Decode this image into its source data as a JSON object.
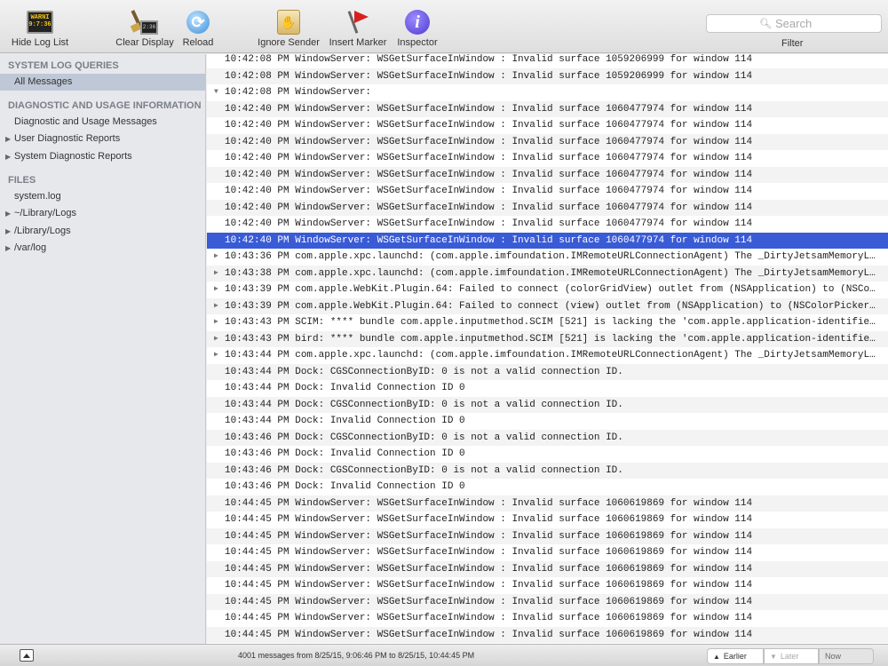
{
  "toolbar": {
    "hide_log_list": "Hide Log List",
    "clear_display": "Clear Display",
    "reload": "Reload",
    "ignore_sender": "Ignore Sender",
    "insert_marker": "Insert Marker",
    "inspector": "Inspector",
    "console_icon_text": "WARNI\n9:7:36",
    "clear_icon_text": "2:36",
    "search_placeholder": "Search",
    "filter": "Filter"
  },
  "sidebar": {
    "system_log_queries": "SYSTEM LOG QUERIES",
    "all_messages": "All Messages",
    "diagnostic_header": "DIAGNOSTIC AND USAGE INFORMATION",
    "diagnostic_messages": "Diagnostic and Usage Messages",
    "user_reports": "User Diagnostic Reports",
    "system_reports": "System Diagnostic Reports",
    "files_header": "FILES",
    "system_log": "system.log",
    "user_library_logs": "~/Library/Logs",
    "library_logs": "/Library/Logs",
    "var_log": "/var/log"
  },
  "log": {
    "rows": [
      {
        "text": "10:42:08 PM WindowServer: WSGetSurfaceInWindow : Invalid surface 1059206999 for window 114",
        "disc": ""
      },
      {
        "text": "10:42:08 PM WindowServer: WSGetSurfaceInWindow : Invalid surface 1059206999 for window 114",
        "disc": ""
      },
      {
        "text": "10:42:08 PM WindowServer:",
        "disc": "▼"
      },
      {
        "text": "10:42:40 PM WindowServer: WSGetSurfaceInWindow : Invalid surface 1060477974 for window 114",
        "disc": ""
      },
      {
        "text": "10:42:40 PM WindowServer: WSGetSurfaceInWindow : Invalid surface 1060477974 for window 114",
        "disc": ""
      },
      {
        "text": "10:42:40 PM WindowServer: WSGetSurfaceInWindow : Invalid surface 1060477974 for window 114",
        "disc": ""
      },
      {
        "text": "10:42:40 PM WindowServer: WSGetSurfaceInWindow : Invalid surface 1060477974 for window 114",
        "disc": ""
      },
      {
        "text": "10:42:40 PM WindowServer: WSGetSurfaceInWindow : Invalid surface 1060477974 for window 114",
        "disc": ""
      },
      {
        "text": "10:42:40 PM WindowServer: WSGetSurfaceInWindow : Invalid surface 1060477974 for window 114",
        "disc": ""
      },
      {
        "text": "10:42:40 PM WindowServer: WSGetSurfaceInWindow : Invalid surface 1060477974 for window 114",
        "disc": ""
      },
      {
        "text": "10:42:40 PM WindowServer: WSGetSurfaceInWindow : Invalid surface 1060477974 for window 114",
        "disc": ""
      },
      {
        "text": "10:42:40 PM WindowServer: WSGetSurfaceInWindow : Invalid surface 1060477974 for window 114",
        "disc": "",
        "selected": true
      },
      {
        "text": "10:43:36 PM com.apple.xpc.launchd: (com.apple.imfoundation.IMRemoteURLConnectionAgent) The _DirtyJetsamMemoryL…",
        "disc": "▶"
      },
      {
        "text": "10:43:38 PM com.apple.xpc.launchd: (com.apple.imfoundation.IMRemoteURLConnectionAgent) The _DirtyJetsamMemoryL…",
        "disc": "▶"
      },
      {
        "text": "10:43:39 PM com.apple.WebKit.Plugin.64: Failed to connect (colorGridView) outlet from (NSApplication) to (NSCo…",
        "disc": "▶"
      },
      {
        "text": "10:43:39 PM com.apple.WebKit.Plugin.64: Failed to connect (view) outlet from (NSApplication) to (NSColorPicker…",
        "disc": "▶"
      },
      {
        "text": "10:43:43 PM SCIM: **** bundle com.apple.inputmethod.SCIM [521] is lacking the 'com.apple.application-identifie…",
        "disc": "▶"
      },
      {
        "text": "10:43:43 PM bird: **** bundle com.apple.inputmethod.SCIM [521] is lacking the 'com.apple.application-identifie…",
        "disc": "▶"
      },
      {
        "text": "10:43:44 PM com.apple.xpc.launchd: (com.apple.imfoundation.IMRemoteURLConnectionAgent) The _DirtyJetsamMemoryL…",
        "disc": "▶"
      },
      {
        "text": "10:43:44 PM Dock: CGSConnectionByID: 0 is not a valid connection ID.",
        "disc": ""
      },
      {
        "text": "10:43:44 PM Dock: Invalid Connection ID 0",
        "disc": ""
      },
      {
        "text": "10:43:44 PM Dock: CGSConnectionByID: 0 is not a valid connection ID.",
        "disc": ""
      },
      {
        "text": "10:43:44 PM Dock: Invalid Connection ID 0",
        "disc": ""
      },
      {
        "text": "10:43:46 PM Dock: CGSConnectionByID: 0 is not a valid connection ID.",
        "disc": ""
      },
      {
        "text": "10:43:46 PM Dock: Invalid Connection ID 0",
        "disc": ""
      },
      {
        "text": "10:43:46 PM Dock: CGSConnectionByID: 0 is not a valid connection ID.",
        "disc": ""
      },
      {
        "text": "10:43:46 PM Dock: Invalid Connection ID 0",
        "disc": ""
      },
      {
        "text": "10:44:45 PM WindowServer: WSGetSurfaceInWindow : Invalid surface 1060619869 for window 114",
        "disc": ""
      },
      {
        "text": "10:44:45 PM WindowServer: WSGetSurfaceInWindow : Invalid surface 1060619869 for window 114",
        "disc": ""
      },
      {
        "text": "10:44:45 PM WindowServer: WSGetSurfaceInWindow : Invalid surface 1060619869 for window 114",
        "disc": ""
      },
      {
        "text": "10:44:45 PM WindowServer: WSGetSurfaceInWindow : Invalid surface 1060619869 for window 114",
        "disc": ""
      },
      {
        "text": "10:44:45 PM WindowServer: WSGetSurfaceInWindow : Invalid surface 1060619869 for window 114",
        "disc": ""
      },
      {
        "text": "10:44:45 PM WindowServer: WSGetSurfaceInWindow : Invalid surface 1060619869 for window 114",
        "disc": ""
      },
      {
        "text": "10:44:45 PM WindowServer: WSGetSurfaceInWindow : Invalid surface 1060619869 for window 114",
        "disc": ""
      },
      {
        "text": "10:44:45 PM WindowServer: WSGetSurfaceInWindow : Invalid surface 1060619869 for window 114",
        "disc": ""
      },
      {
        "text": "10:44:45 PM WindowServer: WSGetSurfaceInWindow : Invalid surface 1060619869 for window 114",
        "disc": ""
      }
    ]
  },
  "status": {
    "message": "4001 messages from 8/25/15, 9:06:46 PM to 8/25/15, 10:44:45 PM",
    "earlier": "Earlier",
    "later": "Later",
    "now": "Now"
  },
  "colors": {
    "selection": "#3a5bd6",
    "sidebar_selection": "#bfc8d6"
  }
}
